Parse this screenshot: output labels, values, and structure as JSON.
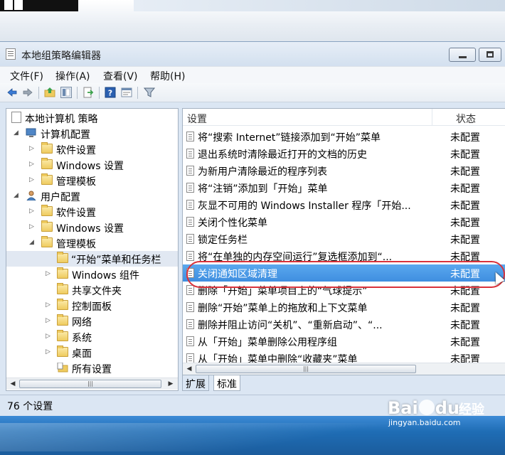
{
  "window": {
    "title": "本地组策略编辑器"
  },
  "menubar": {
    "items": [
      "文件(F)",
      "操作(A)",
      "查看(V)",
      "帮助(H)"
    ]
  },
  "toolbar": {
    "icons": [
      "back-arrow-icon",
      "forward-arrow-icon",
      "up-folder-icon",
      "show-hide-tree-icon",
      "export-list-icon",
      "help-icon",
      "properties-icon",
      "filter-icon"
    ]
  },
  "tree": {
    "nodes": [
      {
        "label": "本地计算机 策略",
        "level": 0,
        "expander": "",
        "icon": "policy-doc"
      },
      {
        "label": "计算机配置",
        "level": 1,
        "expander": "◢",
        "icon": "computer"
      },
      {
        "label": "软件设置",
        "level": 2,
        "expander": "▷",
        "icon": "folder"
      },
      {
        "label": "Windows 设置",
        "level": 2,
        "expander": "▷",
        "icon": "folder"
      },
      {
        "label": "管理模板",
        "level": 2,
        "expander": "▷",
        "icon": "folder"
      },
      {
        "label": "用户配置",
        "level": 1,
        "expander": "◢",
        "icon": "user"
      },
      {
        "label": "软件设置",
        "level": 2,
        "expander": "▷",
        "icon": "folder"
      },
      {
        "label": "Windows 设置",
        "level": 2,
        "expander": "▷",
        "icon": "folder"
      },
      {
        "label": "管理模板",
        "level": 2,
        "expander": "◢",
        "icon": "folder"
      },
      {
        "label": "“开始”菜单和任务栏",
        "level": 3,
        "expander": "",
        "icon": "folder"
      },
      {
        "label": "Windows 组件",
        "level": 3,
        "expander": "▷",
        "icon": "folder"
      },
      {
        "label": "共享文件夹",
        "level": 3,
        "expander": "",
        "icon": "folder"
      },
      {
        "label": "控制面板",
        "level": 3,
        "expander": "▷",
        "icon": "folder"
      },
      {
        "label": "网络",
        "level": 3,
        "expander": "▷",
        "icon": "folder"
      },
      {
        "label": "系统",
        "level": 3,
        "expander": "▷",
        "icon": "folder"
      },
      {
        "label": "桌面",
        "level": 3,
        "expander": "▷",
        "icon": "folder"
      },
      {
        "label": "所有设置",
        "level": 3,
        "expander": "",
        "icon": "all-settings"
      }
    ]
  },
  "list": {
    "col_setting": "设置",
    "col_state": "状态",
    "rows": [
      {
        "name": "将“搜索 Internet”链接添加到“开始”菜单",
        "state": "未配置"
      },
      {
        "name": "退出系统时清除最近打开的文档的历史",
        "state": "未配置"
      },
      {
        "name": "为新用户清除最近的程序列表",
        "state": "未配置"
      },
      {
        "name": "将“注销”添加到「开始」菜单",
        "state": "未配置"
      },
      {
        "name": "灰显不可用的 Windows Installer 程序「开始...",
        "state": "未配置"
      },
      {
        "name": "关闭个性化菜单",
        "state": "未配置"
      },
      {
        "name": "锁定任务栏",
        "state": "未配置"
      },
      {
        "name": "将“在单独的内存空间运行”复选框添加到“...",
        "state": "未配置"
      },
      {
        "name": "关闭通知区域清理",
        "state": "未配置"
      },
      {
        "name": "删除「开始」菜单项目上的“气球提示”",
        "state": "未配置"
      },
      {
        "name": "删除“开始”菜单上的拖放和上下文菜单",
        "state": "未配置"
      },
      {
        "name": "删除并阻止访问“关机”、“重新启动”、“...",
        "state": "未配置"
      },
      {
        "name": "从「开始」菜单删除公用程序组",
        "state": "未配置"
      },
      {
        "name": "从「开始」菜单中删除“收藏夹”菜单",
        "state": "未配置"
      }
    ]
  },
  "tabs": [
    "扩展",
    "标准"
  ],
  "status": {
    "text": "76 个设置"
  },
  "watermark": {
    "logo": "Bai",
    "logo_tail": "du",
    "jingyan": "经验",
    "site": "jingyan.baidu.com"
  },
  "colors": {
    "selection": "#3f8ee0",
    "callout": "#d9323a"
  }
}
